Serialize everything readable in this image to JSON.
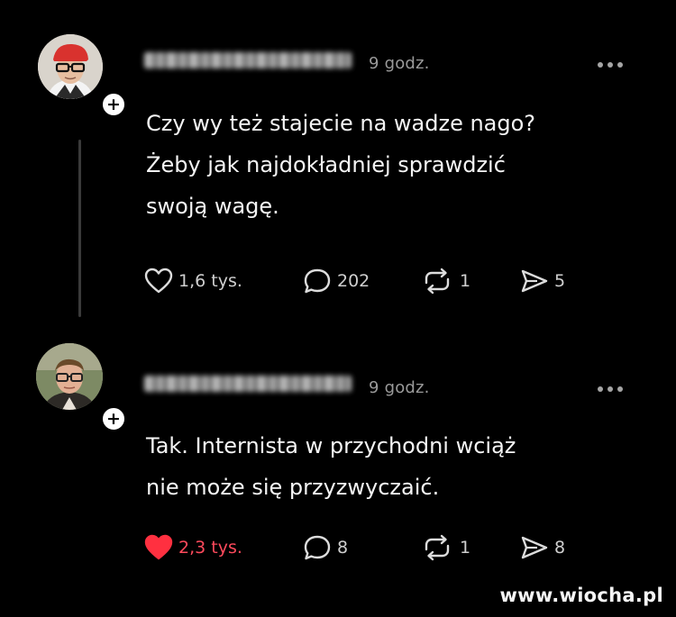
{
  "posts": [
    {
      "timestamp": "9 godz.",
      "text_lines": [
        "Czy wy też stajecie na wadze nago?",
        "Żeby jak najdokładniej sprawdzić",
        "swoją wagę."
      ],
      "likes": "1,6 tys.",
      "liked": false,
      "comments": "202",
      "reposts": "1",
      "shares": "5",
      "avatar_icon": "avatar-red-beanie-glasses",
      "follow_icon": "plus-icon"
    },
    {
      "timestamp": "9 godz.",
      "text_lines": [
        "Tak. Internista w przychodni wciąż",
        "nie może się przyzwyczaić."
      ],
      "likes": "2,3 tys.",
      "liked": true,
      "comments": "8",
      "reposts": "1",
      "shares": "8",
      "avatar_icon": "avatar-man-glasses",
      "follow_icon": "plus-icon"
    }
  ],
  "icons": {
    "like": "heart-icon",
    "comment": "comment-bubble-icon",
    "repost": "repost-arrows-icon",
    "share": "send-icon",
    "more": "more-dots-icon"
  },
  "colors": {
    "background": "#000000",
    "text": "#f4f4f4",
    "muted": "#9a9a9a",
    "liked_red": "#ff4a5c"
  },
  "watermark": "www.wiocha.pl"
}
